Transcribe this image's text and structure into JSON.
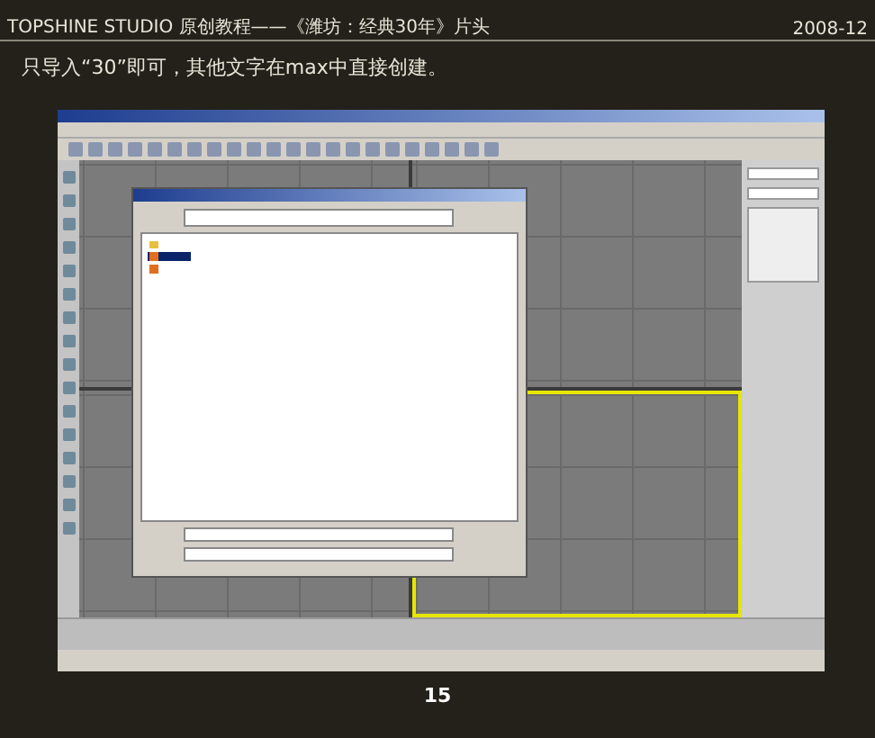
{
  "header": {
    "title": "TOPSHINE STUDIO 原创教程——《潍坊：经典30年》片头",
    "date": "2008-12"
  },
  "instruction": "只导入“30”即可，其他文字在max中直接创建。",
  "screenshot": {
    "viewports": [
      {
        "selected": false
      },
      {
        "selected": false
      },
      {
        "selected": false
      },
      {
        "selected": true
      }
    ],
    "dialog": {
      "items": [
        {
          "kind": "folder",
          "selected": false
        },
        {
          "kind": "file",
          "selected": true
        },
        {
          "kind": "file",
          "selected": false
        }
      ]
    }
  },
  "page_number": "15"
}
